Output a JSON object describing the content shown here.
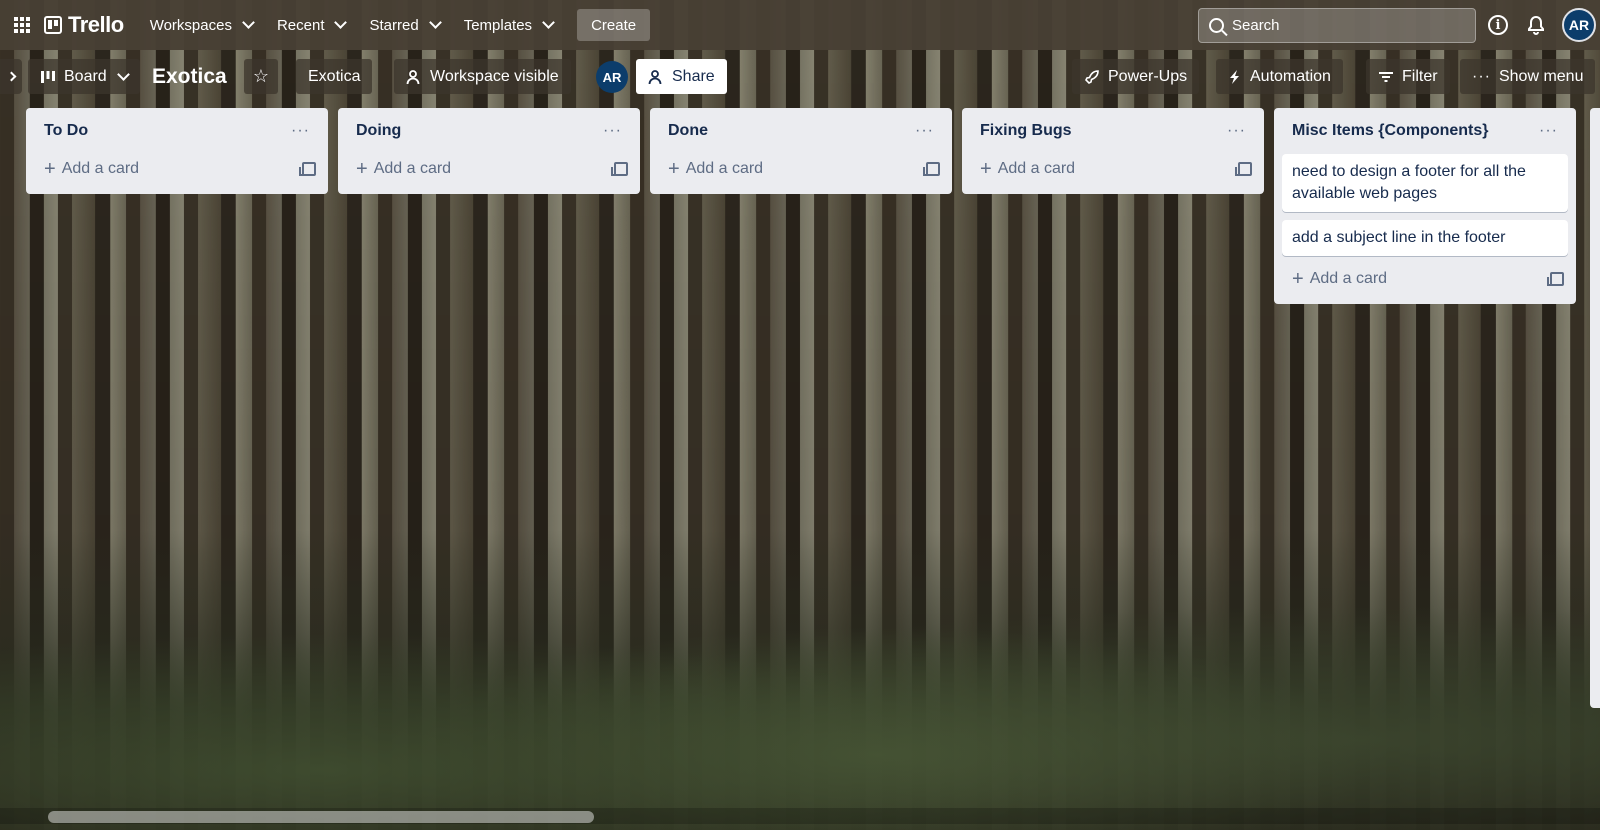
{
  "topbar": {
    "app_name": "Trello",
    "nav": [
      {
        "label": "Workspaces"
      },
      {
        "label": "Recent"
      },
      {
        "label": "Starred"
      },
      {
        "label": "Templates"
      }
    ],
    "create_label": "Create",
    "search_placeholder": "Search",
    "avatar_initials": "AR"
  },
  "board": {
    "view_label": "Board",
    "title": "Exotica",
    "workspace_label": "Exotica",
    "visibility_label": "Workspace visible",
    "member_initials": "AR",
    "share_label": "Share",
    "powerups_label": "Power-Ups",
    "automation_label": "Automation",
    "filter_label": "Filter",
    "show_menu_label": "Show menu"
  },
  "lists": [
    {
      "title": "To Do",
      "cards": [],
      "add_label": "Add a card"
    },
    {
      "title": "Doing",
      "cards": [],
      "add_label": "Add a card"
    },
    {
      "title": "Done",
      "cards": [],
      "add_label": "Add a card"
    },
    {
      "title": "Fixing Bugs",
      "cards": [],
      "add_label": "Add a card"
    },
    {
      "title": "Misc Items {Components}",
      "cards": [
        "need to design a footer for all the available web pages",
        "add a subject line in the footer"
      ],
      "add_label": "Add a card"
    }
  ],
  "icons": {
    "menu": "ellipsis-icon",
    "add": "plus-icon",
    "template": "card-template-icon"
  }
}
